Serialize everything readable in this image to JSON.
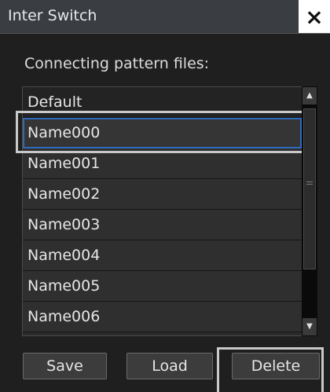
{
  "dialog": {
    "title": "Inter Switch",
    "close_icon": "×",
    "subtitle": "Connecting pattern files:"
  },
  "files": [
    {
      "name": "Default",
      "selected": false
    },
    {
      "name": "Name000",
      "selected": true
    },
    {
      "name": "Name001",
      "selected": false
    },
    {
      "name": "Name002",
      "selected": false
    },
    {
      "name": "Name003",
      "selected": false
    },
    {
      "name": "Name004",
      "selected": false
    },
    {
      "name": "Name005",
      "selected": false
    },
    {
      "name": "Name006",
      "selected": false
    }
  ],
  "scrollbar": {
    "up_icon": "▲",
    "down_icon": "▼"
  },
  "buttons": {
    "save": "Save",
    "load": "Load",
    "delete": "Delete"
  },
  "colors": {
    "selection_border": "#2f6bbd",
    "background": "#1f1f1f"
  }
}
